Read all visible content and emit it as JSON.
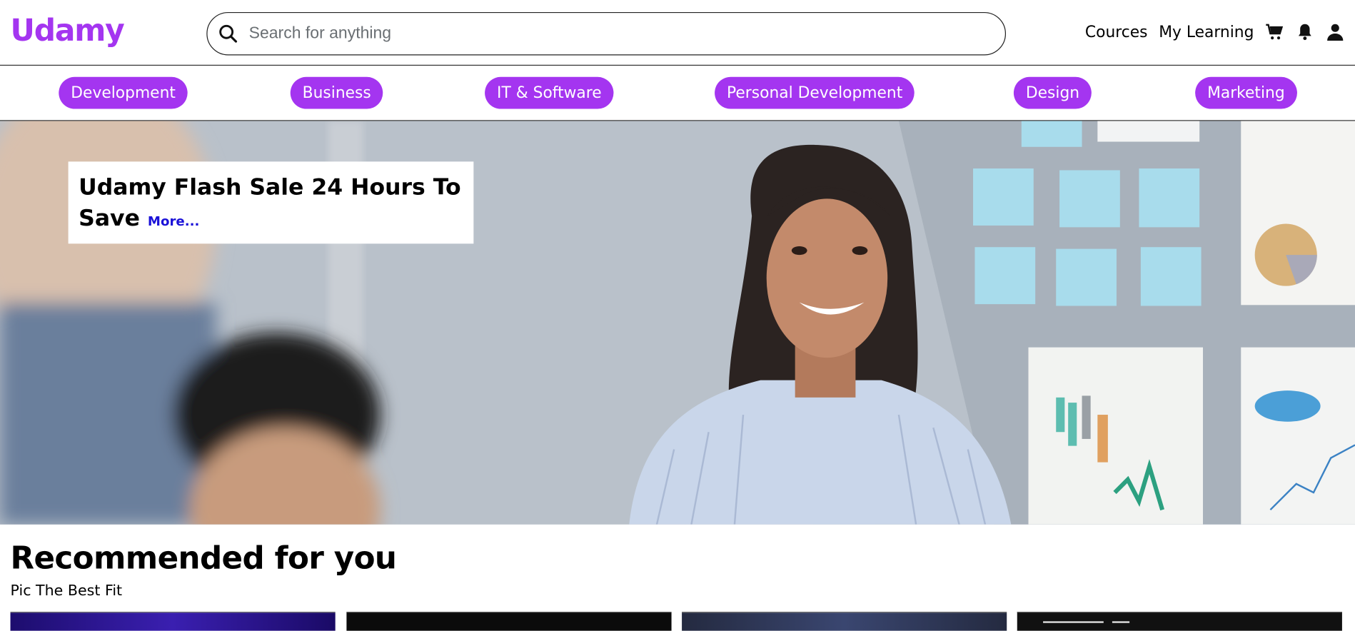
{
  "header": {
    "logo": "Udamy",
    "search_placeholder": "Search for anything",
    "nav_links": [
      "Cources",
      "My Learning"
    ],
    "icons": [
      "cart-icon",
      "bell-icon",
      "user-icon"
    ]
  },
  "categories": [
    "Development",
    "Business",
    "IT & Software",
    "Personal Development",
    "Design",
    "Marketing"
  ],
  "hero": {
    "title": "Udamy Flash Sale 24 Hours To Save",
    "more_link": "More..."
  },
  "recommended": {
    "title": "Recommended for you",
    "subtitle": "Pic The Best Fit"
  },
  "colors": {
    "brand": "#a435f0",
    "link": "#1b12d8"
  }
}
